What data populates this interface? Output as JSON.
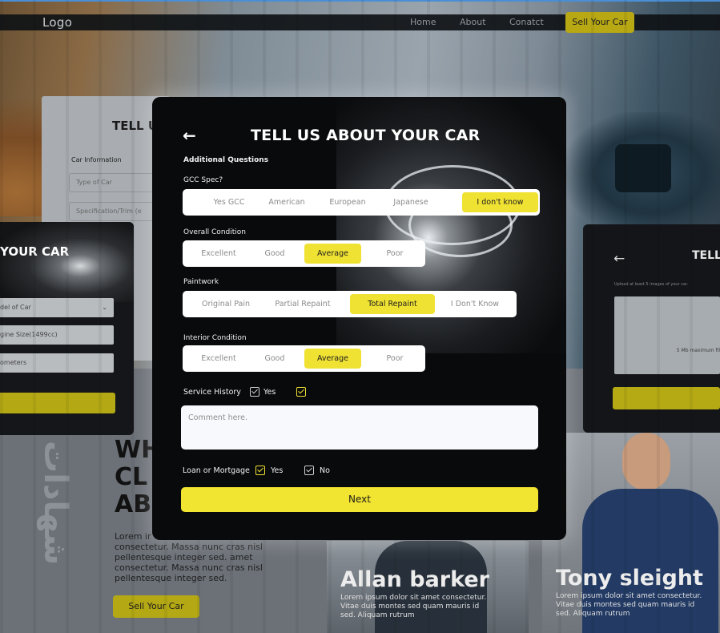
{
  "navbar": {
    "logo": "Logo",
    "links": [
      "Home",
      "About",
      "Conatct"
    ],
    "sell_button": "Sell Your Car"
  },
  "background_left_card": {
    "title": "TELL U",
    "section_label": "Car Information",
    "inputs": [
      "Type of Car",
      "Specification/Trim (e"
    ]
  },
  "background_dark_left": {
    "title": "YOUR CAR",
    "inputs": [
      "del of Car",
      "gine Size(1499cc)",
      "ometers"
    ]
  },
  "background_dark_right": {
    "title": "TELL",
    "note": "Upload at least 5 images of your car.",
    "upload_hint": "5 Mb maximum fil"
  },
  "background_bottom": {
    "arabic": "شهادات",
    "headline": [
      "WH",
      "CL",
      "AB"
    ],
    "lorem_left": "Lorem ir\nconsectetur. Massa nunc cras nisl pellentesque integer sed. amet consectetur. Massa nunc cras nisl pellentesque integer sed.",
    "sell_button": "Sell Your Car",
    "people": [
      {
        "name": "Allan barker",
        "text": "Lorem ipsum dolor sit amet consectetur. Vitae duis montes sed quam mauris id sed. Aliquam rutrum"
      },
      {
        "name": "Tony sleight",
        "text": "Lorem ipsum dolor sit amet consectetur. Vitae duis montes sed quam mauris id sed. Aliquam rutrum"
      }
    ]
  },
  "modal": {
    "back_icon": "arrow-left-icon",
    "title": "TELL US ABOUT YOUR CAR",
    "subtitle": "Additional Questions",
    "gcc": {
      "label": "GCC Spec?",
      "options": [
        "Yes GCC",
        "American",
        "European",
        "Japanese",
        "I don't know"
      ],
      "selected": "I don't know"
    },
    "overall": {
      "label": "Overall Condition",
      "options": [
        "Excellent",
        "Good",
        "Average",
        "Poor"
      ],
      "selected": "Average"
    },
    "paintwork": {
      "label": "Paintwork",
      "options": [
        "Original Pain",
        "Partial Repaint",
        "Total Repaint",
        "I Don't Know"
      ],
      "selected": "Total Repaint"
    },
    "interior": {
      "label": "Interior Condition",
      "options": [
        "Excellent",
        "Good",
        "Average",
        "Poor"
      ],
      "selected": "Average"
    },
    "service_history": {
      "label": "Service History",
      "yes_label": "Yes"
    },
    "comment": {
      "placeholder": "Comment here."
    },
    "loan": {
      "label": "Loan or Mortgage",
      "yes_label": "Yes",
      "no_label": "No"
    },
    "next_button": "Next"
  },
  "colors": {
    "accent": "#f1e531",
    "modal_bg": "#090a0c",
    "option_bg": "#ffffff"
  }
}
